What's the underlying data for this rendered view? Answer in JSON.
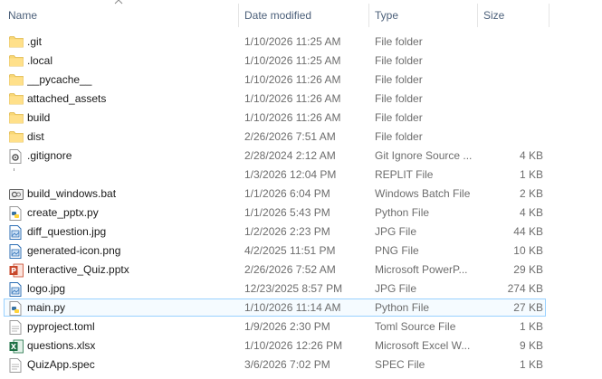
{
  "columns": {
    "name": "Name",
    "date": "Date modified",
    "type": "Type",
    "size": "Size"
  },
  "files": [
    {
      "name": ".git",
      "date": "1/10/2026 11:25 AM",
      "type": "File folder",
      "size": "",
      "icon": "folder-icon"
    },
    {
      "name": ".local",
      "date": "1/10/2026 11:25 AM",
      "type": "File folder",
      "size": "",
      "icon": "folder-icon"
    },
    {
      "name": "__pycache__",
      "date": "1/10/2026 11:26 AM",
      "type": "File folder",
      "size": "",
      "icon": "folder-icon"
    },
    {
      "name": "attached_assets",
      "date": "1/10/2026 11:26 AM",
      "type": "File folder",
      "size": "",
      "icon": "folder-icon"
    },
    {
      "name": "build",
      "date": "1/10/2026 11:26 AM",
      "type": "File folder",
      "size": "",
      "icon": "folder-icon"
    },
    {
      "name": "dist",
      "date": "2/26/2026 7:51 AM",
      "type": "File folder",
      "size": "",
      "icon": "folder-icon"
    },
    {
      "name": ".gitignore",
      "date": "2/28/2024 2:12 AM",
      "type": "Git Ignore Source ...",
      "size": "4 KB",
      "icon": "gear-file-icon"
    },
    {
      "name": "",
      "date": "1/3/2026 12:04 PM",
      "type": "REPLIT File",
      "size": "1 KB",
      "icon": "blank-icon"
    },
    {
      "name": "build_windows.bat",
      "date": "1/1/2026 6:04 PM",
      "type": "Windows Batch File",
      "size": "2 KB",
      "icon": "batch-file-icon"
    },
    {
      "name": "create_pptx.py",
      "date": "1/1/2026 5:43 PM",
      "type": "Python File",
      "size": "4 KB",
      "icon": "python-file-icon"
    },
    {
      "name": "diff_question.jpg",
      "date": "1/2/2026 2:23 PM",
      "type": "JPG File",
      "size": "44 KB",
      "icon": "image-file-icon"
    },
    {
      "name": "generated-icon.png",
      "date": "4/2/2025 11:51 PM",
      "type": "PNG File",
      "size": "10 KB",
      "icon": "image-file-icon"
    },
    {
      "name": "Interactive_Quiz.pptx",
      "date": "2/26/2026 7:52 AM",
      "type": "Microsoft PowerP...",
      "size": "29 KB",
      "icon": "powerpoint-file-icon"
    },
    {
      "name": "logo.jpg",
      "date": "12/23/2025 8:57 PM",
      "type": "JPG File",
      "size": "274 KB",
      "icon": "image-file-icon"
    },
    {
      "name": "main.py",
      "date": "1/10/2026 11:14 AM",
      "type": "Python File",
      "size": "27 KB",
      "icon": "python-file-icon",
      "selected": true
    },
    {
      "name": "pyproject.toml",
      "date": "1/9/2026 2:30 PM",
      "type": "Toml Source File",
      "size": "1 KB",
      "icon": "text-file-icon"
    },
    {
      "name": "questions.xlsx",
      "date": "1/10/2026 12:26 PM",
      "type": "Microsoft Excel W...",
      "size": "9 KB",
      "icon": "excel-file-icon"
    },
    {
      "name": "QuizApp.spec",
      "date": "3/6/2026 7:02 PM",
      "type": "SPEC File",
      "size": "1 KB",
      "icon": "text-file-icon"
    }
  ]
}
